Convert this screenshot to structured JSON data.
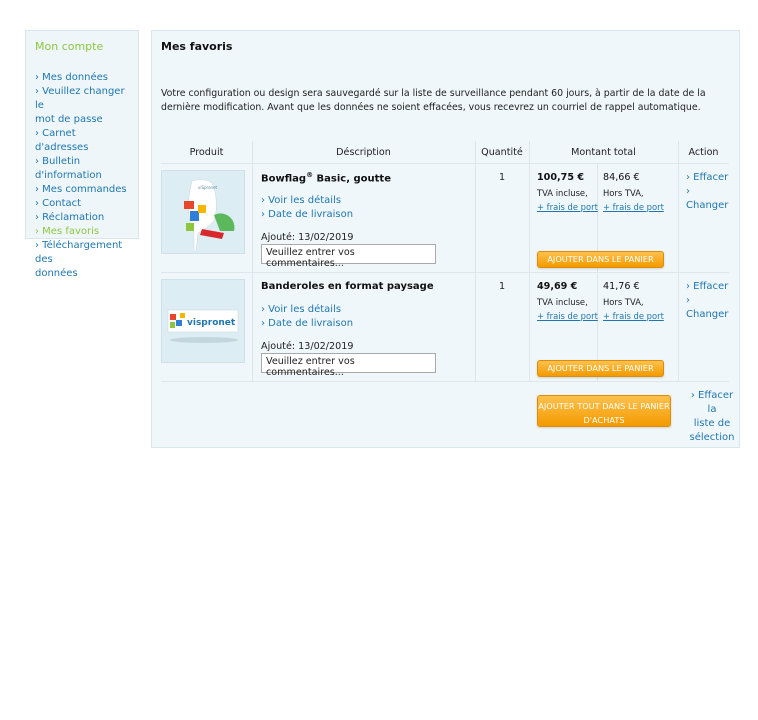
{
  "sidebar": {
    "title": "Mon compte",
    "items": [
      {
        "label": "› Mes données"
      },
      {
        "label": "› Veuillez changer le"
      },
      {
        "label": "mot de passe"
      },
      {
        "label": "› Carnet d'adresses"
      },
      {
        "label": "› Bulletin d'information"
      },
      {
        "label": "› Mes commandes"
      },
      {
        "label": "› Contact"
      },
      {
        "label": "› Réclamation"
      },
      {
        "label": "› Mes favoris"
      },
      {
        "label": "› Téléchargement des"
      },
      {
        "label": "données"
      }
    ]
  },
  "main": {
    "title": "Mes favoris",
    "intro": "Votre configuration ou design sera sauvegardé sur la liste de surveillance pendant 60 jours, à partir de la date de la dernière modification. Avant que les données ne soient effacées, vous recevrez un courriel de rappel automatique.",
    "headers": {
      "produit": "Produit",
      "description": "Déscription",
      "quantite": "Quantité",
      "montant": "Montant total",
      "action": "Action"
    },
    "products": [
      {
        "name": "Bowflag",
        "reg": "®",
        "name_rest": " Basic, goutte",
        "link_details": "› Voir les détails",
        "link_delivery": "› Date de livraison",
        "added": "Ajouté: 13/02/2019",
        "comment_placeholder": "Veuillez entrer vos commentaires...",
        "quantity": "1",
        "price_ttc": "100,75 €",
        "price_ht": "84,66 €",
        "tva_incl": "TVA incluse,",
        "hors_tva": "Hors TVA,",
        "frais1": "+ frais de port",
        "frais2": "+ frais de port",
        "add_btn": "AJOUTER DANS LE PANIER",
        "action_delete": "› Effacer",
        "action_arrow": "›",
        "action_change": "Changer",
        "thumb_text": "viSpronet"
      },
      {
        "name": "Banderoles en format paysage",
        "link_details": "› Voir les détails",
        "link_delivery": "› Date de livraison",
        "added": "Ajouté: 13/02/2019",
        "comment_placeholder": "Veuillez entrer vos commentaires...",
        "quantity": "1",
        "price_ttc": "49,69 €",
        "price_ht": "41,76 €",
        "tva_incl": "TVA incluse,",
        "hors_tva": "Hors TVA,",
        "frais1": "+ frais de port",
        "frais2": "+ frais de port",
        "add_btn": "AJOUTER DANS LE PANIER",
        "action_delete": "› Effacer",
        "action_arrow": "›",
        "action_change": "Changer",
        "thumb_text": "vispronet"
      }
    ],
    "add_all_line1": "AJOUTER TOUT DANS LE PANIER",
    "add_all_line2": "D'ACHATS",
    "clear_line1": "› Effacer la",
    "clear_line2": "liste de",
    "clear_line3": "sélection"
  },
  "colors": {
    "link": "#1f76b0",
    "accent_green": "#8cc63f",
    "button_orange": "#f39a00",
    "panel_bg": "#f0f7fa"
  }
}
